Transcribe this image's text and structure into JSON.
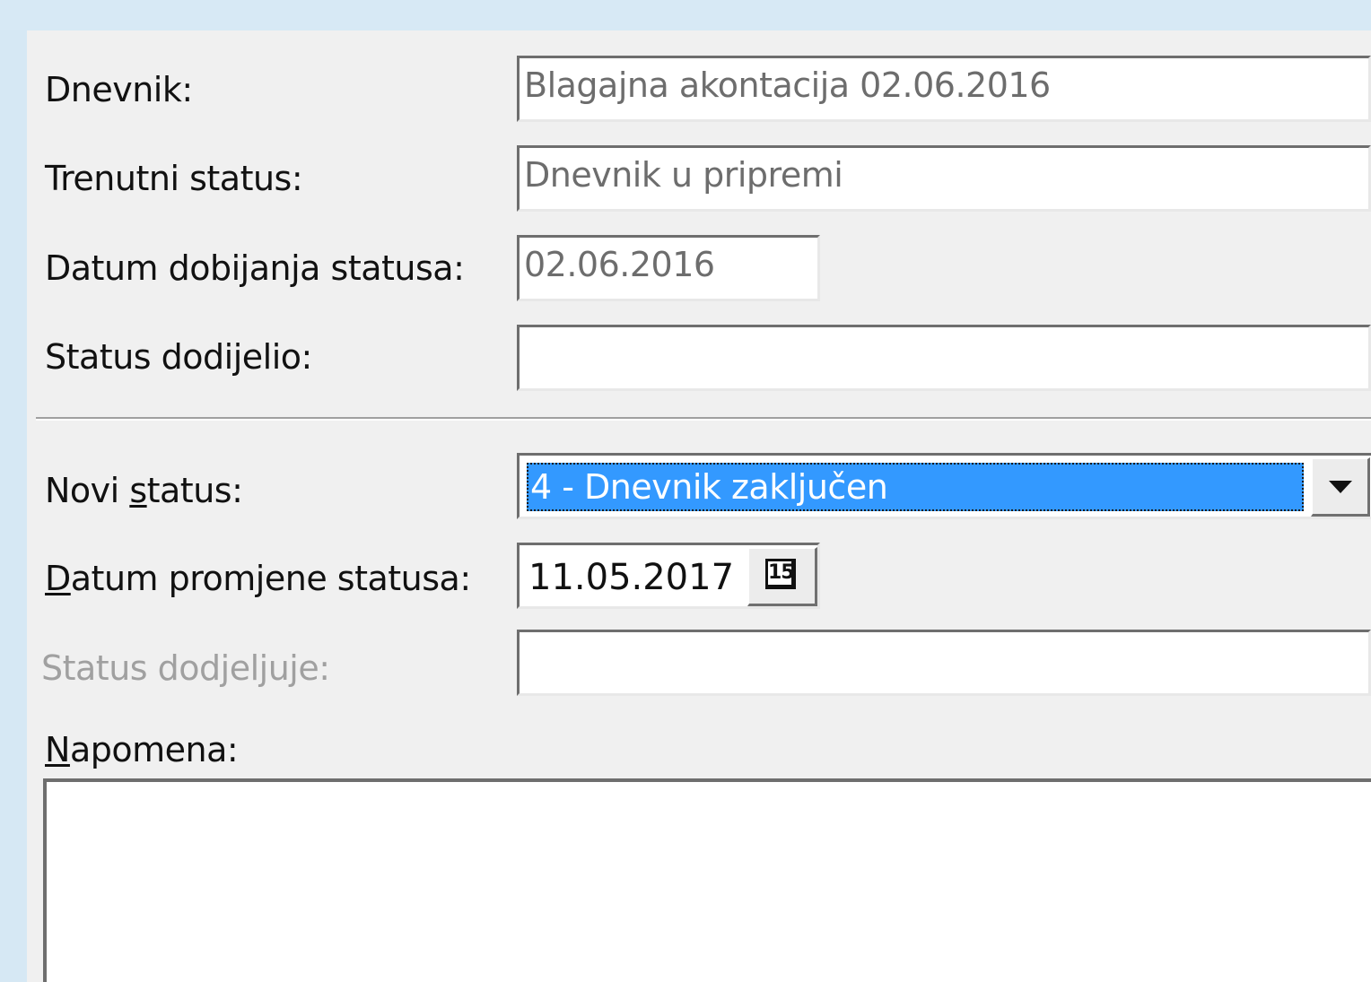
{
  "form": {
    "dnevnik_label": "Dnevnik:",
    "dnevnik_value": "Blagajna akontacija 02.06.2016",
    "trenutni_status_label": "Trenutni status:",
    "trenutni_status_value": "Dnevnik u pripremi",
    "datum_dobijanja_label": "Datum dobijanja statusa:",
    "datum_dobijanja_value": "02.06.2016",
    "status_dodijelio_label": "Status dodijelio:",
    "status_dodijelio_value": "",
    "novi_status_label_pre": "Novi ",
    "novi_status_label_accel": "s",
    "novi_status_label_post": "tatus:",
    "novi_status_value": "4 - Dnevnik zaključen",
    "datum_promjene_label_accel": "D",
    "datum_promjene_label_post": "atum promjene statusa:",
    "datum_promjene_value": "11.05.2017",
    "calendar_icon_text": "15",
    "status_dodjeljuje_label": "Status dodjeljuje:",
    "status_dodjeljuje_value": "",
    "napomena_label_accel": "N",
    "napomena_label_post": "apomena:",
    "napomena_value": ""
  },
  "icons": {
    "dropdown": "chevron-down-icon",
    "calendar": "calendar-icon"
  },
  "colors": {
    "selection": "#3399ff",
    "panel_bg": "#f0f0f0",
    "disabled_text": "#a0a0a0"
  }
}
